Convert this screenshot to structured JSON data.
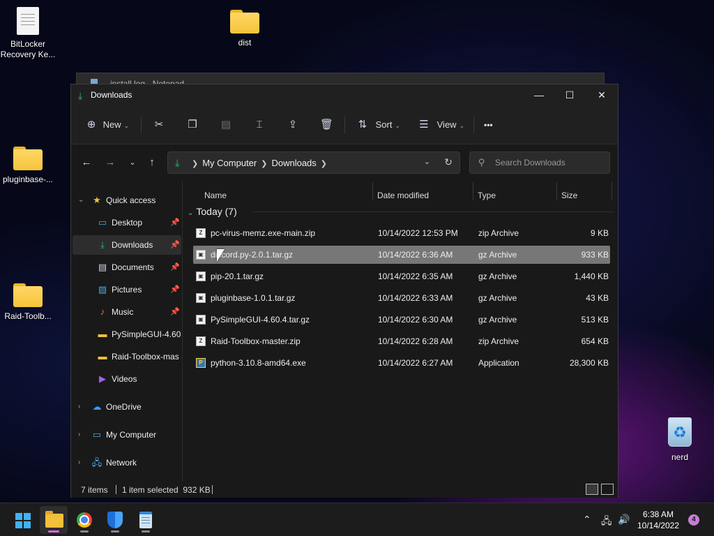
{
  "desktop": {
    "icons": [
      {
        "label": "BitLocker Recovery Ke...",
        "icon": "document-icon"
      },
      {
        "label": "dist",
        "icon": "folder-icon"
      },
      {
        "label": "pluginbase-...",
        "icon": "folder-icon"
      },
      {
        "label": "Raid-Toolb...",
        "icon": "folder-icon"
      },
      {
        "label": "nerd",
        "icon": "recycle-bin-icon"
      }
    ]
  },
  "notepad": {
    "title": "install.log - Notepad"
  },
  "explorer": {
    "title": "Downloads",
    "toolbar": {
      "new_label": "New",
      "sort_label": "Sort",
      "view_label": "View",
      "more_label": "•••"
    },
    "address": {
      "crumbs": [
        "My Computer",
        "Downloads"
      ]
    },
    "search": {
      "placeholder": "Search Downloads"
    },
    "nav": {
      "quick_access": "Quick access",
      "items": [
        {
          "label": "Desktop",
          "icon": "desktop-icon",
          "pinned": true
        },
        {
          "label": "Downloads",
          "icon": "download-icon",
          "pinned": true
        },
        {
          "label": "Documents",
          "icon": "documents-icon",
          "pinned": true
        },
        {
          "label": "Pictures",
          "icon": "pictures-icon",
          "pinned": true
        },
        {
          "label": "Music",
          "icon": "music-icon",
          "pinned": true
        },
        {
          "label": "PySimpleGUI-4.60.",
          "icon": "folder-icon",
          "pinned": false
        },
        {
          "label": "Raid-Toolbox-mas",
          "icon": "folder-icon",
          "pinned": false
        },
        {
          "label": "Videos",
          "icon": "videos-icon",
          "pinned": false
        }
      ],
      "onedrive": "OneDrive",
      "my_computer": "My Computer",
      "network": "Network"
    },
    "columns": {
      "name": "Name",
      "date": "Date modified",
      "type": "Type",
      "size": "Size"
    },
    "group": {
      "label": "Today (7)"
    },
    "files": [
      {
        "name": "pc-virus-memz.exe-main.zip",
        "date": "10/14/2022 12:53 PM",
        "type": "zip Archive",
        "size": "9 KB",
        "icon": "zip-icon"
      },
      {
        "name": "discord.py-2.0.1.tar.gz",
        "date": "10/14/2022 6:36 AM",
        "type": "gz Archive",
        "size": "933 KB",
        "icon": "archive-icon"
      },
      {
        "name": "pip-20.1.tar.gz",
        "date": "10/14/2022 6:35 AM",
        "type": "gz Archive",
        "size": "1,440 KB",
        "icon": "archive-icon"
      },
      {
        "name": "pluginbase-1.0.1.tar.gz",
        "date": "10/14/2022 6:33 AM",
        "type": "gz Archive",
        "size": "43 KB",
        "icon": "archive-icon"
      },
      {
        "name": "PySimpleGUI-4.60.4.tar.gz",
        "date": "10/14/2022 6:30 AM",
        "type": "gz Archive",
        "size": "513 KB",
        "icon": "archive-icon"
      },
      {
        "name": "Raid-Toolbox-master.zip",
        "date": "10/14/2022 6:28 AM",
        "type": "zip Archive",
        "size": "654 KB",
        "icon": "zip-icon"
      },
      {
        "name": "python-3.10.8-amd64.exe",
        "date": "10/14/2022 6:27 AM",
        "type": "Application",
        "size": "28,300 KB",
        "icon": "python-installer-icon"
      }
    ],
    "status": {
      "items": "7 items",
      "selected": "1 item selected  932 KB"
    }
  },
  "taskbar": {
    "apps": [
      "start-icon",
      "file-explorer-icon",
      "chrome-icon",
      "defender-icon",
      "notepad-icon"
    ],
    "time": "6:38 AM",
    "date": "10/14/2022",
    "notifications": "4"
  },
  "colors": {
    "accent": "#2fbf6f",
    "selection": "#777777",
    "window_bg": "#191919",
    "notify": "#c77dd6"
  }
}
